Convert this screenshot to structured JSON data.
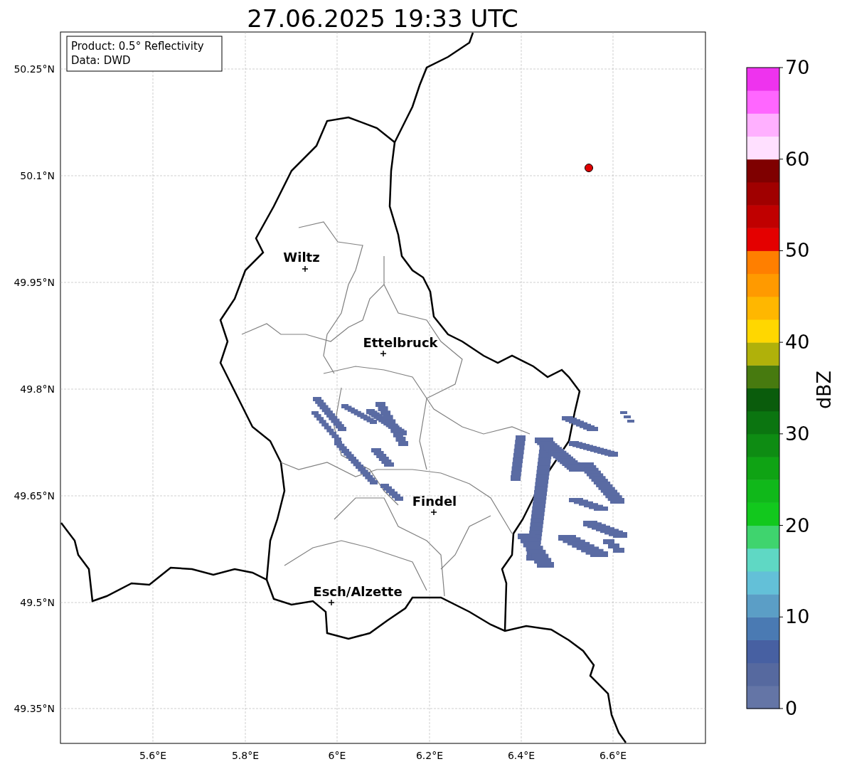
{
  "title": "27.06.2025 19:33 UTC",
  "info_box": [
    "Product: 0.5° Reflectivity",
    "Data: DWD"
  ],
  "map": {
    "lat_ticks": [
      "50.25°N",
      "50.1°N",
      "49.95°N",
      "49.8°N",
      "49.65°N",
      "49.5°N",
      "49.35°N"
    ],
    "lon_ticks": [
      "5.6°E",
      "5.8°E",
      "6°E",
      "6.2°E",
      "6.4°E",
      "6.6°E"
    ],
    "places": [
      {
        "name": "Wiltz"
      },
      {
        "name": "Ettelbruck"
      },
      {
        "name": "Findel"
      },
      {
        "name": "Esch/Alzette"
      }
    ]
  },
  "colorbar": {
    "label": "dBZ",
    "ticks": [
      "70",
      "60",
      "50",
      "40",
      "30",
      "20",
      "10",
      "0"
    ],
    "bands": [
      {
        "color": "#6475a6"
      },
      {
        "color": "#56699f"
      },
      {
        "color": "#4760a2"
      },
      {
        "color": "#4a7ab3"
      },
      {
        "color": "#5b9ec6"
      },
      {
        "color": "#63c0d8"
      },
      {
        "color": "#5fd8c4"
      },
      {
        "color": "#3fd46e"
      },
      {
        "color": "#12c81d"
      },
      {
        "color": "#10b81a"
      },
      {
        "color": "#0fa314"
      },
      {
        "color": "#0e8c13"
      },
      {
        "color": "#0b7510"
      },
      {
        "color": "#0a5c0c"
      },
      {
        "color": "#477a0f"
      },
      {
        "color": "#b0b10a"
      },
      {
        "color": "#ffd700"
      },
      {
        "color": "#ffb700"
      },
      {
        "color": "#ff9a00"
      },
      {
        "color": "#ff7f00"
      },
      {
        "color": "#e40000"
      },
      {
        "color": "#c00000"
      },
      {
        "color": "#a00000"
      },
      {
        "color": "#7f0000"
      },
      {
        "color": "#ffe0ff"
      },
      {
        "color": "#ffb0ff"
      },
      {
        "color": "#ff66ff"
      },
      {
        "color": "#ee33ee"
      }
    ]
  }
}
